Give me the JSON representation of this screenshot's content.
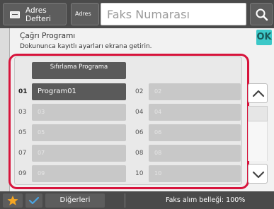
{
  "topbar": {
    "address_book_label": "Adres Defteri",
    "address_label": "Adres",
    "fax_number_placeholder": "Faks Numarası"
  },
  "header": {
    "title": "Çağrı Programı",
    "subtitle": "Dokununca kayıtlı ayarları ekrana getirin.",
    "ok_label": "OK"
  },
  "reset_button_label": "Sıfırlama Programa",
  "programs": [
    {
      "number": "01",
      "label": "Program01",
      "filled": true
    },
    {
      "number": "02",
      "label": "02",
      "filled": false
    },
    {
      "number": "03",
      "label": "03",
      "filled": false
    },
    {
      "number": "04",
      "label": "04",
      "filled": false
    },
    {
      "number": "05",
      "label": "05",
      "filled": false
    },
    {
      "number": "06",
      "label": "06",
      "filled": false
    },
    {
      "number": "07",
      "label": "07",
      "filled": false
    },
    {
      "number": "08",
      "label": "08",
      "filled": false
    },
    {
      "number": "09",
      "label": "09",
      "filled": false
    },
    {
      "number": "10",
      "label": "10",
      "filled": false
    }
  ],
  "bottombar": {
    "others_label": "Diğerleri",
    "fax_memory_text": "Faks alım belleği: 100%"
  },
  "colors": {
    "highlight_frame": "#d7143c",
    "ok_button": "#3cc8c8",
    "star": "#f5a623",
    "check": "#4aa3e0"
  },
  "icons": {
    "address_book": "address-book-icon",
    "search": "search-icon",
    "favorite": "star-icon",
    "check": "check-icon",
    "scroll_up": "chevron-up-icon",
    "scroll_down": "chevron-down-icon"
  }
}
